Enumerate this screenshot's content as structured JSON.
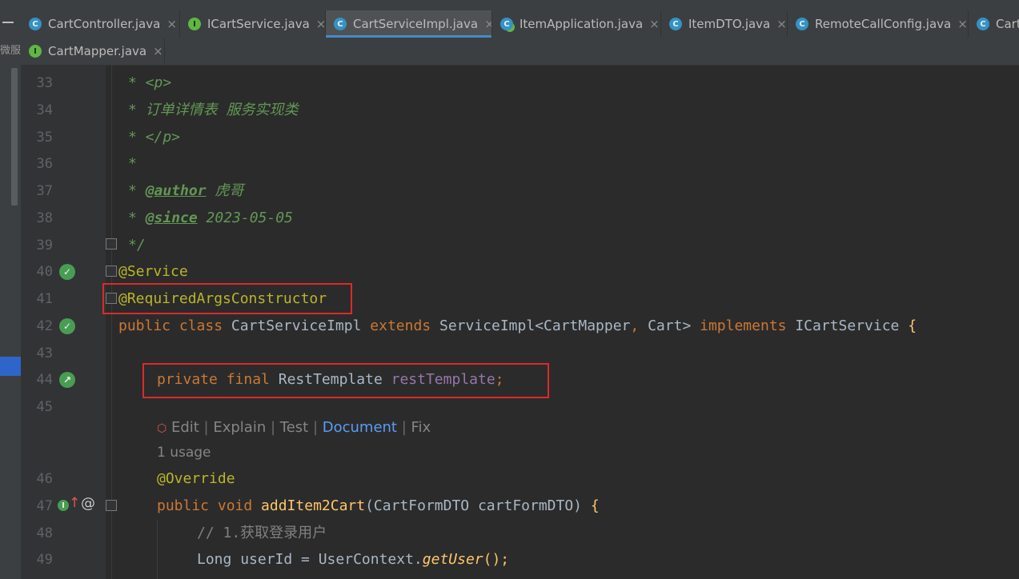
{
  "tabs_row1": [
    {
      "label": "CartController.java",
      "icon": "c"
    },
    {
      "label": "ICartService.java",
      "icon": "i"
    },
    {
      "label": "CartServiceImpl.java",
      "icon": "c",
      "active": true
    },
    {
      "label": "ItemApplication.java",
      "icon": "a"
    },
    {
      "label": "ItemDTO.java",
      "icon": "c"
    },
    {
      "label": "RemoteCallConfig.java",
      "icon": "c"
    },
    {
      "label": "Cart",
      "icon": "c"
    }
  ],
  "tabs_row2": [
    {
      "label": "CartMapper.java",
      "icon": "i"
    }
  ],
  "close_glyph": "×",
  "left_strip_text": "微服",
  "icon_letters": {
    "c": "C",
    "i": "I",
    "a": "C"
  },
  "gutter_glyphs": {
    "impl": "✓",
    "arrow": "↗",
    "override_letter": "I",
    "override_arrow": "↑",
    "at": "@"
  },
  "lines": {
    "n33": "33",
    "n34": "34",
    "n35": "35",
    "n36": "36",
    "n37": "37",
    "n38": "38",
    "n39": "39",
    "n40": "40",
    "n41": "41",
    "n42": "42",
    "n43": "43",
    "n44": "44",
    "n45": "45",
    "n46": "46",
    "n47": "47",
    "n48": "48",
    "n49": "49"
  },
  "code": {
    "l33": "* <p>",
    "l34": "* 订单详情表 服务实现类",
    "l35": "* </p>",
    "l36": "*",
    "l37_star": "* ",
    "l37_tag": "@author",
    "l37_rest": " 虎哥",
    "l38_star": "* ",
    "l38_tag": "@since",
    "l38_rest": " 2023-05-05",
    "l39": "*/",
    "l40": "@Service",
    "l41": "@RequiredArgsConstructor",
    "l42_public": "public",
    "l42_class": " class ",
    "l42_name": "CartServiceImpl ",
    "l42_extends": "extends ",
    "l42_super": "ServiceImpl<CartMapper",
    "l42_comma": ", ",
    "l42_cart": "Cart> ",
    "l42_impl": "implements ",
    "l42_iface": "ICartService ",
    "l42_brace": "{",
    "l44_private": "private ",
    "l44_final": "final ",
    "l44_type": "RestTemplate ",
    "l44_field": "restTemplate",
    "l44_semi": ";",
    "l46": "@Override",
    "l47_public": "public ",
    "l47_void": "void ",
    "l47_method": "addItem2Cart",
    "l47_args": "(CartFormDTO cartFormDTO) ",
    "l47_brace": "{",
    "l48": "// 1.获取登录用户",
    "l49_type": "Long ",
    "l49_var": "userId = UserContext.",
    "l49_call": "getUser",
    "l49_end": "();"
  },
  "hints": {
    "edit": "Edit",
    "explain": "Explain",
    "test": "Test",
    "document": "Document",
    "fix": "Fix",
    "sep": " | ",
    "usage": "1 usage"
  },
  "colors": {
    "comment": "#629755",
    "keyword": "#cc7832",
    "annotation": "#bbb529",
    "field": "#9876aa",
    "method": "#ffc66d",
    "highlight_box": "#e0282a",
    "active_tab_underline": "#4a88c7"
  }
}
